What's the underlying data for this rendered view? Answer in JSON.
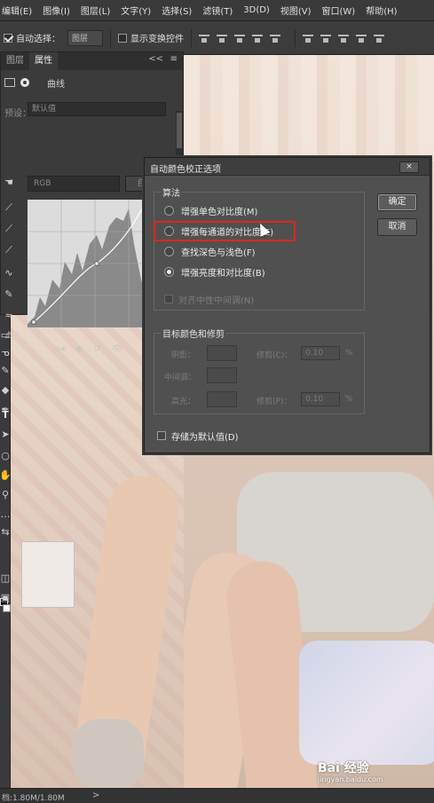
{
  "menubar": {
    "items": [
      "编辑(E)",
      "图像(I)",
      "图层(L)",
      "文字(Y)",
      "选择(S)",
      "滤镜(T)",
      "3D(D)",
      "视图(V)",
      "窗口(W)",
      "帮助(H)"
    ]
  },
  "options": {
    "auto_select_label": "自动选择：",
    "auto_select_checked": true,
    "layer_select_value": "图层",
    "show_transform_label": "显示变换控件",
    "show_transform_checked": false
  },
  "props_panel": {
    "tabs": [
      "图层",
      "属性"
    ],
    "active_tab": "属性",
    "collapse_glyph": "<<",
    "menu_glyph": "≡",
    "adjustment_label": "曲线",
    "preset_label": "预设：",
    "preset_value": "默认值",
    "channel_value": "RGB",
    "auto_button": "自动"
  },
  "dialog": {
    "title": "自动颜色校正选项",
    "close_glyph": "×",
    "algorithm_group": "算法",
    "options": [
      {
        "label": "增强单色对比度(M)",
        "selected": false
      },
      {
        "label": "增强每通道的对比度(E)",
        "selected": false,
        "highlighted": true
      },
      {
        "label": "查找深色与浅色(F)",
        "selected": false
      },
      {
        "label": "增强亮度和对比度(B)",
        "selected": true
      }
    ],
    "snap_neutral": {
      "label": "对齐中性中间调(N)",
      "checked": false,
      "enabled": false
    },
    "ok_button": "确定",
    "cancel_button": "取消",
    "target_group": "目标颜色和修剪",
    "shadows_label": "阴影：",
    "midtones_label": "中间调：",
    "highlights_label": "高光：",
    "clip_shadows_label": "修剪(C)：",
    "clip_shadows_value": "0.10",
    "clip_highlights_label": "修剪(P)：",
    "clip_highlights_value": "0.10",
    "percent_symbol": "%",
    "save_default": {
      "label": "存储为默认值(D)",
      "checked": false
    }
  },
  "statusbar": {
    "doc_info": "档:1.80M/1.80M",
    "nav_arrow": ">"
  },
  "watermark": {
    "brand": "Bai 经验",
    "url": "jingyan.baidu.com"
  },
  "colors": {
    "highlight_red": "#e0261c",
    "ui_dark": "#3b3b3b",
    "dialog_bg": "#505050"
  }
}
